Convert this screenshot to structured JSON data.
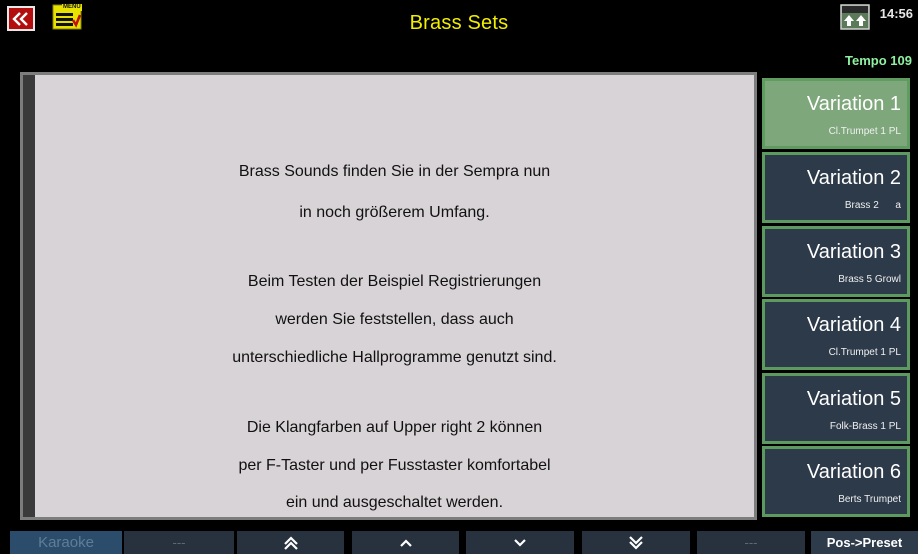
{
  "header": {
    "title": "Brass Sets",
    "menu_label": "MENU",
    "shift_label": "SHIFT",
    "time": "14:56",
    "tempo": "Tempo 109"
  },
  "colors": {
    "title": "#f2ee00",
    "active_variation": "#7ea77c",
    "variation": "#2d3a4a",
    "panel": "#d8d3d6"
  },
  "panel_text": [
    "Brass Sounds finden Sie in der Sempra nun",
    "in noch größerem Umfang.",
    "Beim Testen der Beispiel Registrierungen",
    "werden Sie feststellen, dass auch",
    "unterschiedliche Hallprogramme genutzt sind.",
    "Die Klangfarben auf Upper right 2 können",
    "per F-Taster und per Fusstaster komfortabel",
    "ein und ausgeschaltet werden."
  ],
  "variations": [
    {
      "label": "Variation 1",
      "sound": "Cl.Trumpet 1 PL",
      "active": true
    },
    {
      "label": "Variation 2",
      "sound": "Brass 2      a",
      "active": false
    },
    {
      "label": "Variation 3",
      "sound": "Brass 5 Growl",
      "active": false
    },
    {
      "label": "Variation 4",
      "sound": "Cl.Trumpet 1 PL",
      "active": false
    },
    {
      "label": "Variation 5",
      "sound": "Folk-Brass 1 PL",
      "active": false
    },
    {
      "label": "Variation 6",
      "sound": "Berts Trumpet",
      "active": false
    }
  ],
  "bottom": {
    "karaoke": "Karaoke",
    "blank1": "---",
    "up_double": "⩓",
    "up": "^",
    "down": "⌄",
    "down_double": "⩔",
    "blank2": "---",
    "pos_preset": "Pos->Preset"
  },
  "icons": {
    "back": "double-chevron-left-icon",
    "menu": "menu-icon",
    "shift": "shift-icon"
  }
}
